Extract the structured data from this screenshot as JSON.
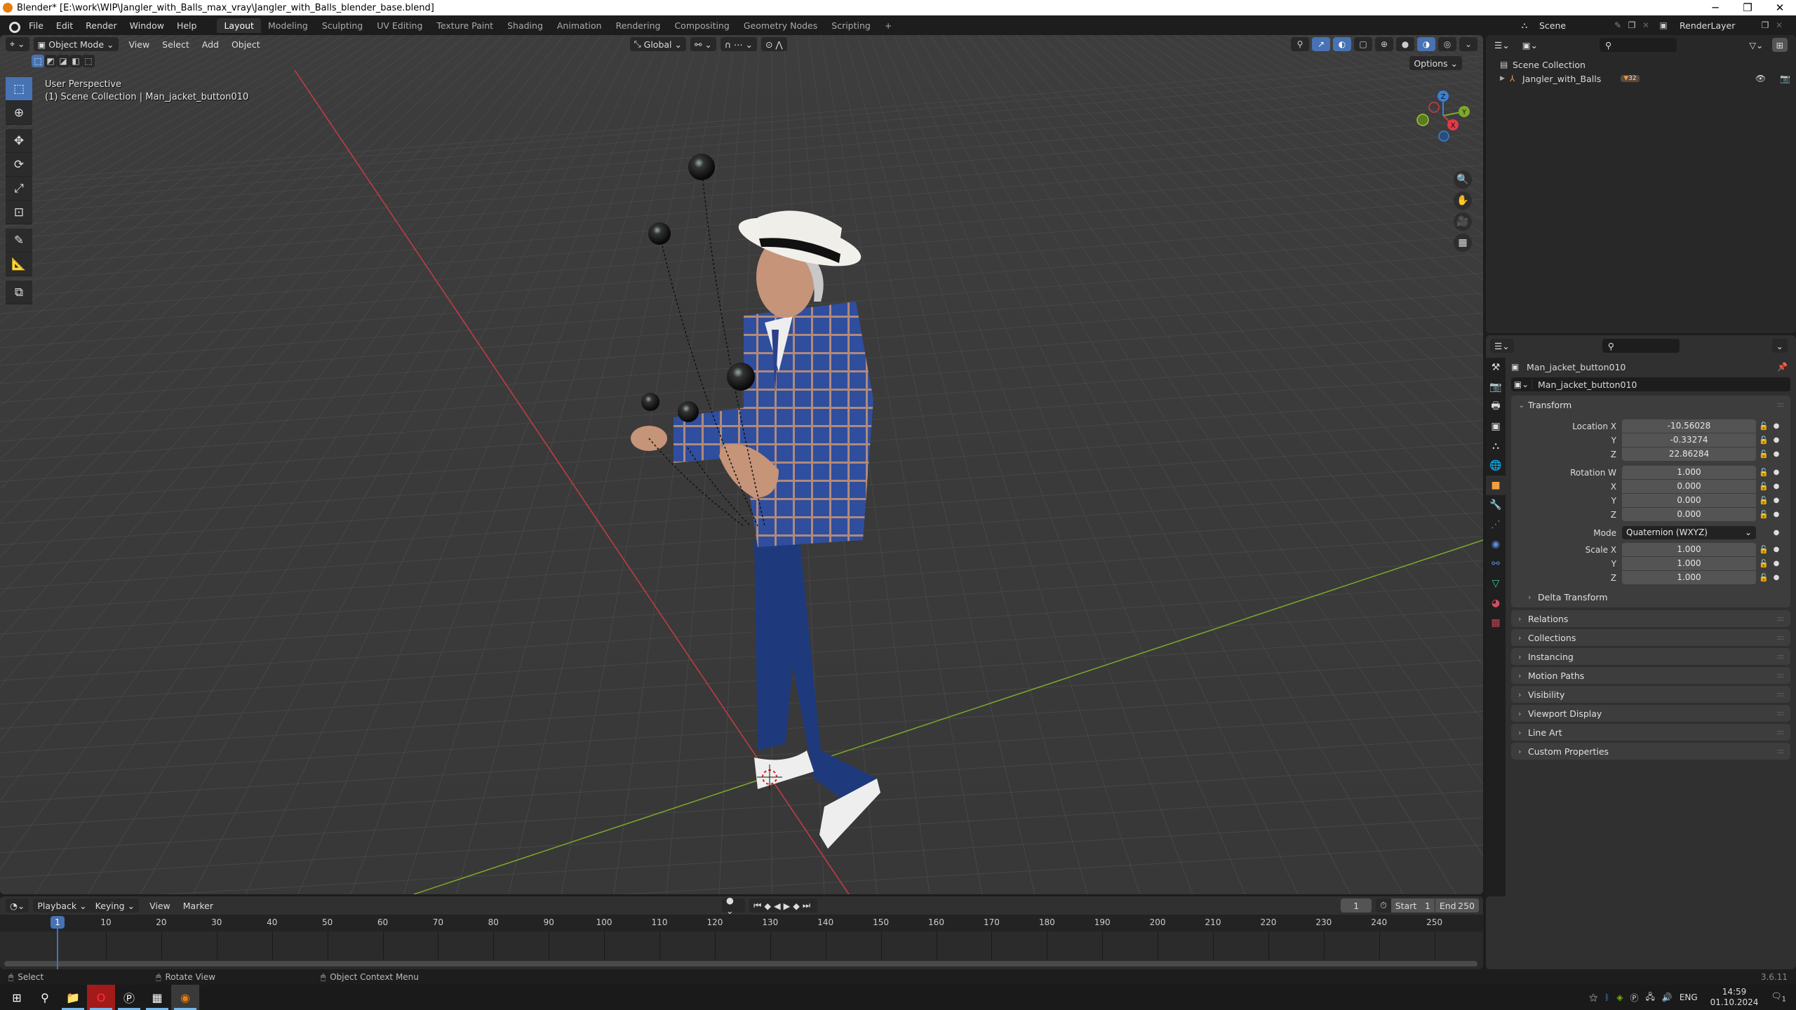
{
  "window": {
    "title": "Blender* [E:\\work\\WIP\\Jangler_with_Balls_max_vray\\Jangler_with_Balls_blender_base.blend]",
    "minimize": "─",
    "maximize": "❐",
    "close": "✕"
  },
  "menubar": {
    "items": [
      "File",
      "Edit",
      "Render",
      "Window",
      "Help"
    ],
    "workspaces": [
      "Layout",
      "Modeling",
      "Sculpting",
      "UV Editing",
      "Texture Paint",
      "Shading",
      "Animation",
      "Rendering",
      "Compositing",
      "Geometry Nodes",
      "Scripting"
    ],
    "active_workspace": "Layout",
    "add_workspace": "+",
    "scene_name": "Scene",
    "view_layer": "RenderLayer"
  },
  "viewport": {
    "mode": "Object Mode",
    "menus": [
      "View",
      "Select",
      "Add",
      "Object"
    ],
    "transform_orientation": "Global",
    "options_label": "Options",
    "overlay_title": "User Perspective",
    "overlay_context": "(1) Scene Collection | Man_jacket_button010",
    "gizmo_axes": {
      "x": "X",
      "y": "Y",
      "z": "Z"
    },
    "colors": {
      "x_axis": "#c93b47",
      "y_axis": "#7fa82a",
      "z_axis": "#3b7fd6",
      "grid_bg": "#3a3a3a",
      "selected_blue": "#4772b3"
    }
  },
  "outliner": {
    "root": "Scene Collection",
    "items": [
      {
        "name": "Jangler_with_Balls",
        "badge": "32"
      }
    ]
  },
  "properties": {
    "object_name": "Man_jacket_button010",
    "object_field": "Man_jacket_button010",
    "transform_label": "Transform",
    "location": {
      "label": "Location X",
      "x": "-10.56028",
      "y": "-0.33274",
      "z": "22.86284"
    },
    "rotation": {
      "label": "Rotation W",
      "w": "1.000",
      "x": "0.000",
      "y": "0.000",
      "z": "0.000"
    },
    "mode_label": "Mode",
    "mode_value": "Quaternion (WXYZ)",
    "scale": {
      "label": "Scale X",
      "x": "1.000",
      "y": "1.000",
      "z": "1.000"
    },
    "axis_labels": {
      "x": "X",
      "y": "Y",
      "z": "Z"
    },
    "delta_transform": "Delta Transform",
    "sections": [
      "Relations",
      "Collections",
      "Instancing",
      "Motion Paths",
      "Visibility",
      "Viewport Display",
      "Line Art",
      "Custom Properties"
    ]
  },
  "timeline": {
    "menus": [
      "Playback",
      "Keying",
      "View",
      "Marker"
    ],
    "current_frame": "1",
    "start_label": "Start",
    "start": "1",
    "end_label": "End",
    "end": "250",
    "ticks": [
      "10",
      "20",
      "30",
      "40",
      "50",
      "60",
      "70",
      "80",
      "90",
      "100",
      "110",
      "120",
      "130",
      "140",
      "150",
      "160",
      "170",
      "180",
      "190",
      "200",
      "210",
      "220",
      "230",
      "240",
      "250"
    ]
  },
  "statusbar": {
    "select": "Select",
    "rotate": "Rotate View",
    "context_menu": "Object Context Menu",
    "version": "3.6.11"
  },
  "taskbar": {
    "language": "ENG",
    "time": "14:59",
    "date": "01.10.2024",
    "notifications": "1"
  }
}
